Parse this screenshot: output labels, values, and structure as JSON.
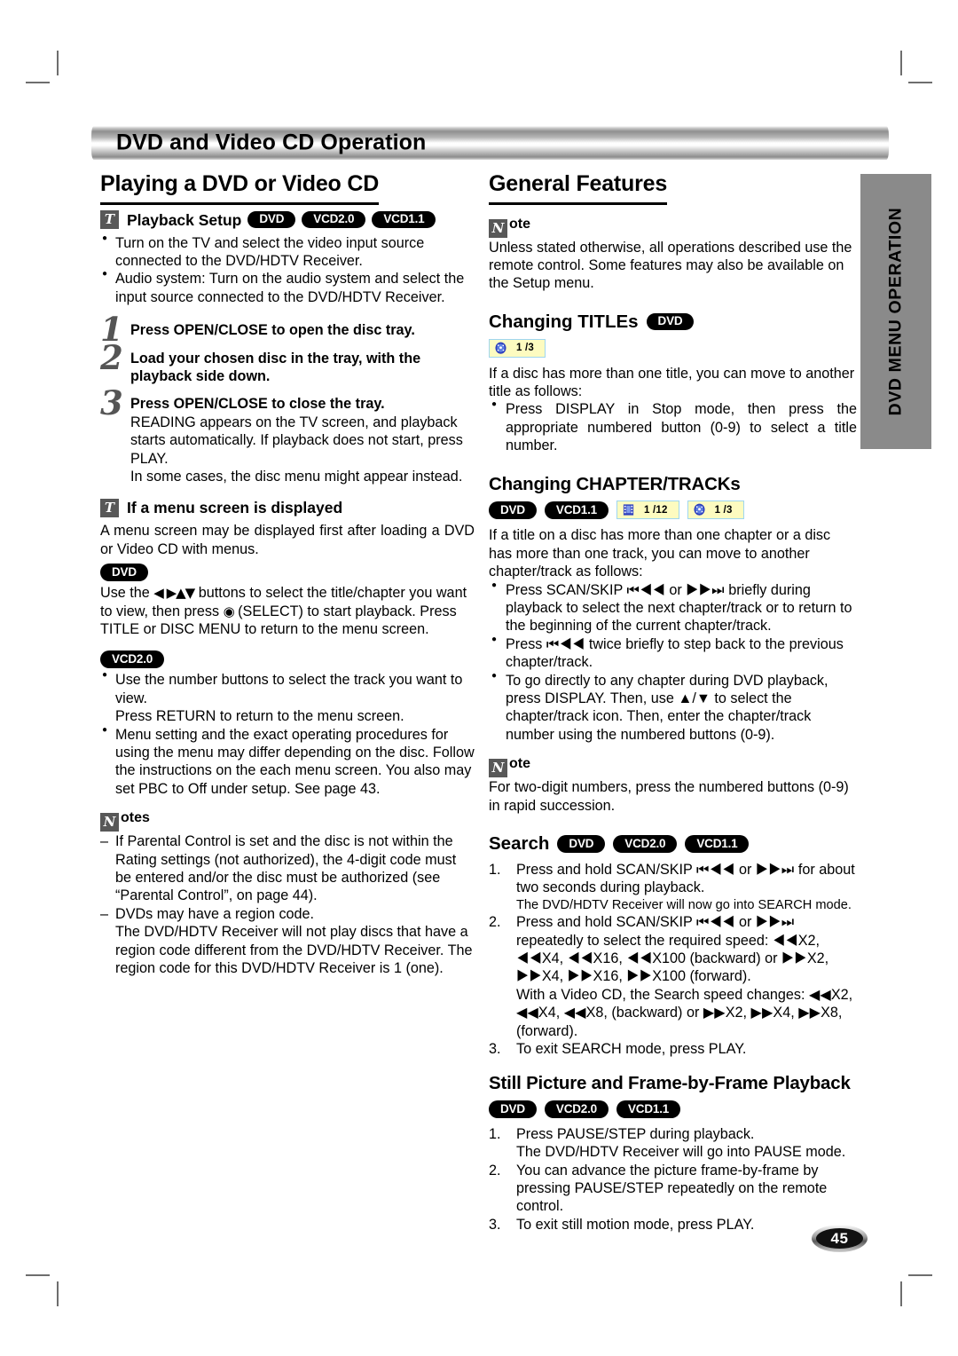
{
  "banner": {
    "title": "DVD and Video CD Operation"
  },
  "side_tab": {
    "label": "DVD MENU OPERATION"
  },
  "page_number": "45",
  "colors": {
    "banner_dark": "#8f8f8f",
    "side_tab_gray": "#8a8a8a",
    "pill_black": "#000000",
    "osd_yellow": "#fdfbc0",
    "osd_border_blue": "#9fd6ef",
    "glyph_box_gray": "#585858"
  },
  "icons": {
    "tip_glyph": "T",
    "note_glyph": "N",
    "film_strip_icon": "film-strip-icon",
    "disc_icon": "disc-icon"
  },
  "left_column": {
    "section_title": "Playing a DVD or Video CD",
    "playback_setup": {
      "heading": "Playback Setup",
      "pills": [
        "DVD",
        "VCD2.0",
        "VCD1.1"
      ],
      "bullets": [
        "Turn on the TV and select the video input source connected to the DVD/HDTV Receiver.",
        "Audio system: Turn on the audio system and select the input source connected to the DVD/HDTV Receiver."
      ]
    },
    "steps": [
      {
        "number": "1",
        "bold": "Press OPEN/CLOSE to open the disc tray.",
        "body": ""
      },
      {
        "number": "2",
        "bold": "Load your chosen disc in the tray, with the playback side down.",
        "body": ""
      },
      {
        "number": "3",
        "bold": "Press OPEN/CLOSE to close the tray.",
        "body": "READING appears on the TV screen, and playback starts automatically. If playback does not start, press PLAY.\nIn some cases, the disc menu might appear instead."
      }
    ],
    "menu_screen": {
      "heading": "If a menu screen is displayed",
      "intro": "A menu screen may be displayed first after loading a DVD or Video CD with menus.",
      "dvd_pill": "DVD",
      "dvd_text_1": "Use the",
      "dvd_arrows": "◀ ▶▲▼",
      "dvd_text_2": "buttons to select the title/chapter you want to view, then press",
      "dvd_select_sym": "◉",
      "dvd_text_3": "(SELECT) to start playback. Press TITLE or DISC MENU to return to the menu screen.",
      "vcd_pill": "VCD2.0",
      "vcd_bullets": [
        "Use the number buttons to select the track you want to view.\nPress RETURN to return to the menu screen.",
        "Menu setting and the exact operating procedures for using the menu may differ depending on the disc. Follow the instructions on the each menu screen. You also may set PBC to Off under setup. See page 43."
      ]
    },
    "notes": {
      "heading": "otes",
      "items": [
        "If Parental Control is set and the disc is not within the Rating settings (not authorized), the 4-digit code must be entered and/or the disc must be authorized (see “Parental Control”, on page 44).",
        "DVDs may have a region code.\nThe DVD/HDTV Receiver will not play discs that have a region code different from the DVD/HDTV Receiver. The region code for this DVD/HDTV Receiver is 1 (one)."
      ]
    }
  },
  "right_column": {
    "section_title": "General Features",
    "note": {
      "heading": "ote",
      "text": "Unless stated otherwise, all operations described use the remote control. Some features may also be available on the Setup menu."
    },
    "changing_titles": {
      "heading": "Changing TITLEs",
      "pill": "DVD",
      "osd": [
        {
          "icon": "disc-icon",
          "value": "1 /3"
        }
      ],
      "intro": "If a disc has more than one title, you can move to another title as follows:",
      "bullets": [
        "Press DISPLAY in Stop mode, then press the appropriate numbered button (0-9) to select a title number."
      ]
    },
    "changing_chapters": {
      "heading": "Changing CHAPTER/TRACKs",
      "pills": [
        "DVD",
        "VCD1.1"
      ],
      "osd": [
        {
          "icon": "film-strip-icon",
          "value": "1 /12"
        },
        {
          "icon": "disc-icon",
          "value": "1 /3"
        }
      ],
      "intro": "If a title on a disc has more than one chapter or a disc has more than one track, you can move to another chapter/track as follows:",
      "bullets": [
        "Press SCAN/SKIP ⏮◀◀ or ▶▶⏭ briefly during playback to select the next chapter/track or to return to the beginning of the current chapter/track.",
        "Press ⏮◀◀ twice briefly to step back to the previous chapter/track.",
        "To go directly to any chapter during DVD playback, press DISPLAY. Then, use ▲/▼ to select the chapter/track icon. Then, enter the chapter/track number using the numbered buttons (0-9)."
      ]
    },
    "note2": {
      "heading": "ote",
      "text": "For two-digit numbers, press the numbered buttons (0-9) in rapid succession."
    },
    "search": {
      "heading": "Search",
      "pills": [
        "DVD",
        "VCD2.0",
        "VCD1.1"
      ],
      "steps": [
        "Press and hold SCAN/SKIP ⏮◀◀ or ▶▶⏭ for about two seconds during playback.",
        "Press and hold SCAN/SKIP ⏮◀◀ or ▶▶⏭ repeatedly to select the required speed: ◀◀X2, ◀◀X4, ◀◀X16, ◀◀X100 (backward) or ▶▶X2, ▶▶X4, ▶▶X16, ▶▶X100 (forward).",
        "To exit SEARCH mode, press PLAY."
      ],
      "step1_subnote": "The DVD/HDTV Receiver will now go into SEARCH mode.",
      "step2_subnote": "With a Video CD, the Search speed changes: ◀◀X2, ◀◀X4, ◀◀X8, (backward) or ▶▶X2, ▶▶X4, ▶▶X8, (forward)."
    },
    "still_picture": {
      "heading": "Still Picture and Frame-by-Frame Playback",
      "pills": [
        "DVD",
        "VCD2.0",
        "VCD1.1"
      ],
      "steps": [
        "Press PAUSE/STEP during playback.",
        "You can advance the picture frame-by-frame by pressing PAUSE/STEP repeatedly on the remote control.",
        "To exit still motion mode, press PLAY."
      ],
      "step1_subnote": "The DVD/HDTV Receiver will go into PAUSE mode."
    }
  }
}
